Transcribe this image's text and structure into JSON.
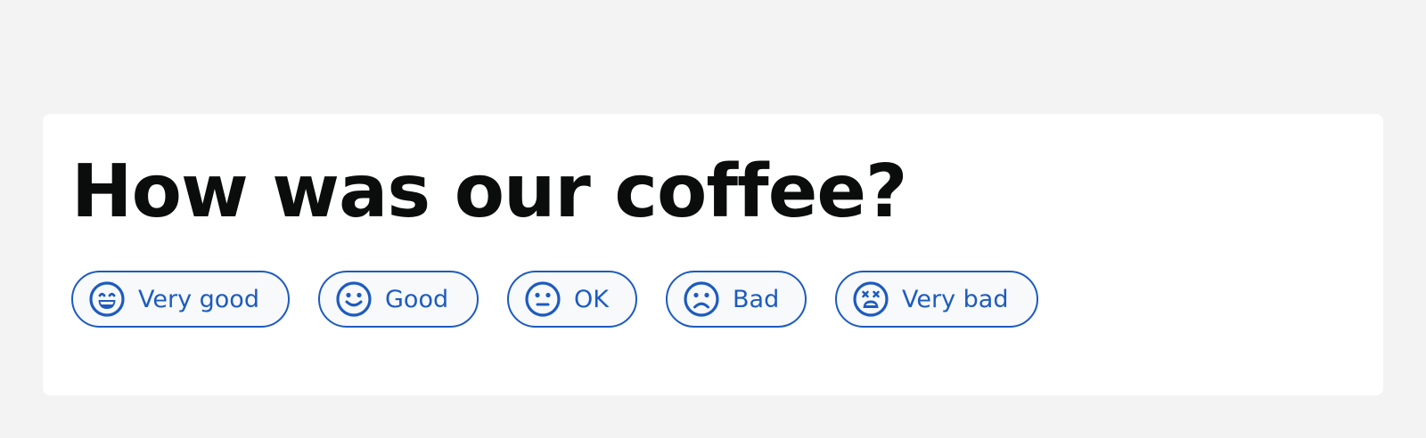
{
  "question": "How was our coffee?",
  "accent_color": "#1d5bbf",
  "options": [
    {
      "label": "Very good",
      "icon": "grin-icon"
    },
    {
      "label": "Good",
      "icon": "smile-icon"
    },
    {
      "label": "OK",
      "icon": "neutral-face-icon"
    },
    {
      "label": "Bad",
      "icon": "frown-icon"
    },
    {
      "label": "Very bad",
      "icon": "dizzy-face-icon"
    }
  ]
}
